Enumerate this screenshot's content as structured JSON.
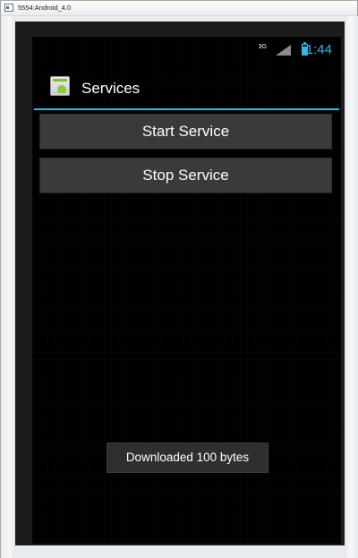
{
  "window": {
    "title": "5554:Android_4.0"
  },
  "statusbar": {
    "network_label": "3G",
    "time": "1:44",
    "accent_color": "#33b5e5",
    "signal_icon": "signal-icon",
    "battery_icon": "battery-icon"
  },
  "actionbar": {
    "title": "Services",
    "app_icon": "android-app-icon"
  },
  "buttons": {
    "start_label": "Start Service",
    "stop_label": "Stop Service"
  },
  "toast": {
    "message": "Downloaded 100 bytes"
  }
}
